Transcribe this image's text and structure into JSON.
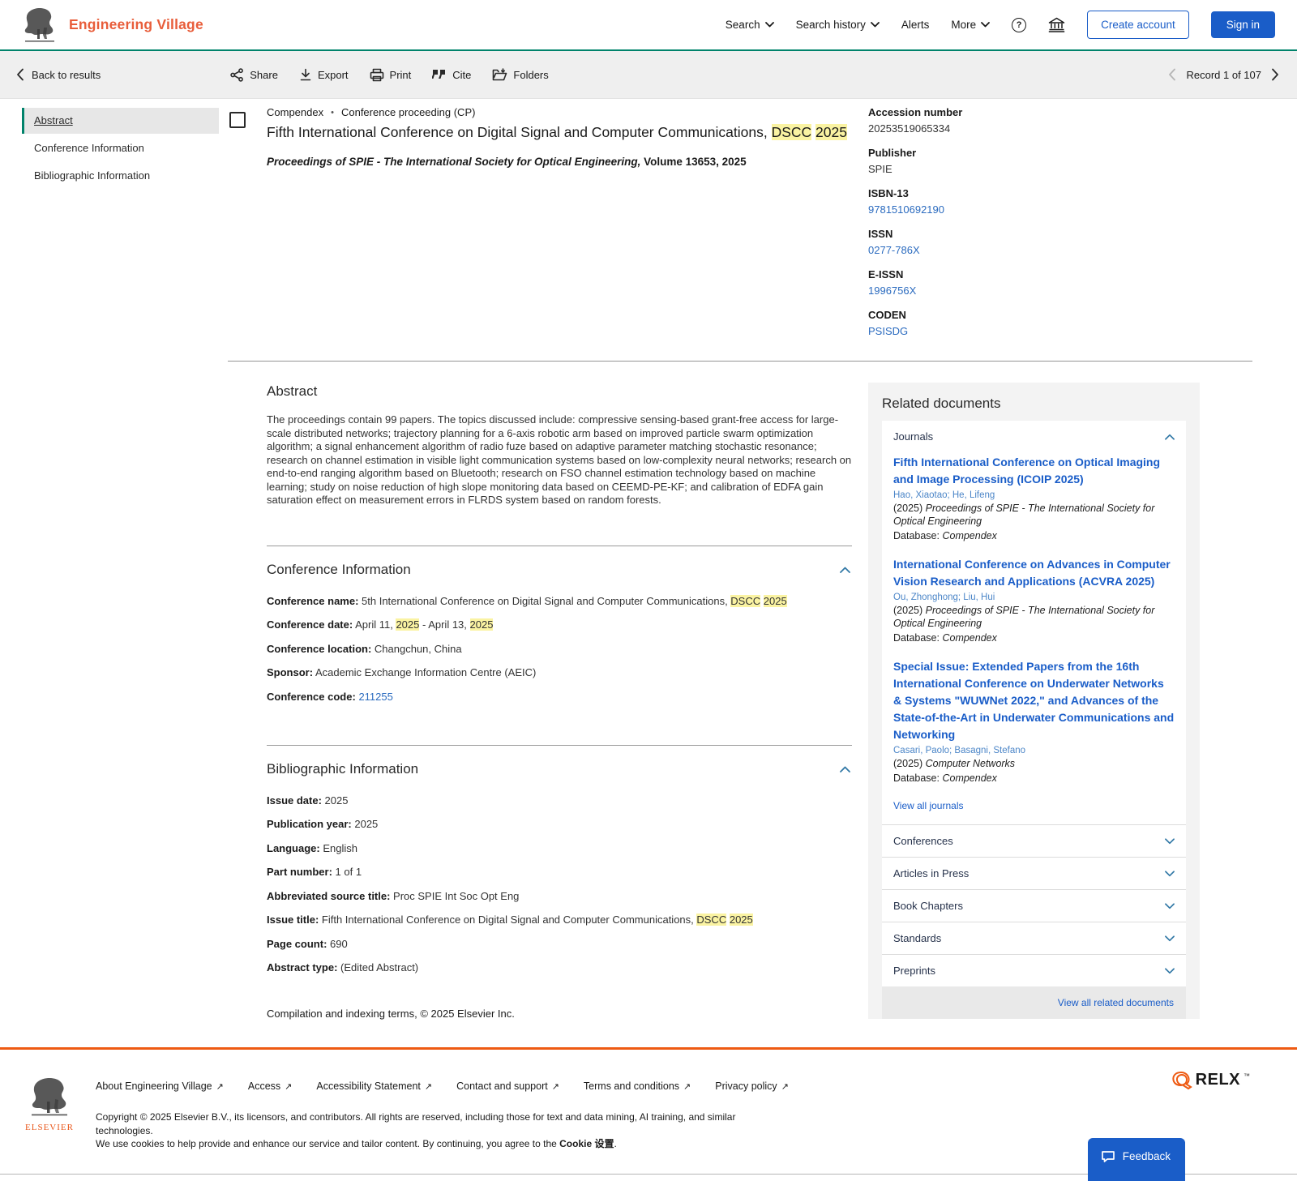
{
  "colors": {
    "brand_orange": "#e85d3a",
    "footer_orange": "#ee5a12",
    "teal": "#00836b",
    "primary_blue": "#1a5dc8",
    "link_blue": "#2b6bbf",
    "highlight": "#faf3a2"
  },
  "header": {
    "brand": "Engineering Village",
    "nav": [
      {
        "label": "Search"
      },
      {
        "label": "Search history"
      },
      {
        "label": "Alerts"
      },
      {
        "label": "More"
      }
    ],
    "create_account": "Create account",
    "sign_in": "Sign in"
  },
  "toolbar": {
    "back": "Back to results",
    "tools": [
      "Share",
      "Export",
      "Print",
      "Cite",
      "Folders"
    ],
    "record_nav": "Record 1 of 107"
  },
  "sidenav": {
    "items": [
      "Abstract",
      "Conference Information",
      "Bibliographic Information"
    ]
  },
  "record": {
    "database": "Compendex",
    "separator": "•",
    "doc_type": "Conference proceeding (CP)",
    "title_parts": [
      {
        "t": "Fifth International Conference on Digital Signal and Computer Communications, "
      },
      {
        "t": "DSCC",
        "m": true
      },
      {
        "t": " "
      },
      {
        "t": "2025",
        "m": true
      }
    ],
    "source_parts": [
      {
        "t": "Proceedings of SPIE - The International Society for Optical Engineering,",
        "b": true,
        "i": true
      },
      {
        "t": " Volume 13653, 2025",
        "b": true
      }
    ]
  },
  "metadata": {
    "groups": [
      {
        "label": "Accession number",
        "value": "20253519065334",
        "link": false
      },
      {
        "label": "Publisher",
        "value": "SPIE",
        "link": false
      },
      {
        "label": "ISBN-13",
        "value": "9781510692190",
        "link": true
      },
      {
        "label": "ISSN",
        "value": "0277-786X",
        "link": true
      },
      {
        "label": "E-ISSN",
        "value": "1996756X",
        "link": true
      },
      {
        "label": "CODEN",
        "value": "PSISDG",
        "link": true
      }
    ]
  },
  "abstract": {
    "heading": "Abstract",
    "text": "The proceedings contain 99 papers. The topics discussed include: compressive sensing-based grant-free access for large-scale distributed networks; trajectory planning for a 6-axis robotic arm based on improved particle swarm optimization algorithm; a signal enhancement algorithm of radio fuze based on adaptive parameter matching stochastic resonance; research on channel estimation in visible light communication systems based on low-complexity neural networks; research on end-to-end ranging algorithm based on Bluetooth; research on FSO channel estimation technology based on machine learning; study on noise reduction of high slope monitoring data based on CEEMD-PE-KF; and calibration of EDFA gain saturation effect on measurement errors in FLRDS system based on random forests."
  },
  "conference": {
    "heading": "Conference Information",
    "rows": [
      {
        "label": "Conference name:",
        "parts": [
          {
            "t": " 5th International Conference on Digital Signal and Computer Communications, "
          },
          {
            "t": "DSCC",
            "m": true
          },
          {
            "t": " "
          },
          {
            "t": "2025",
            "m": true
          }
        ]
      },
      {
        "label": "Conference date:",
        "parts": [
          {
            "t": " April 11, "
          },
          {
            "t": "2025",
            "m": true
          },
          {
            "t": " - April 13, "
          },
          {
            "t": "2025",
            "m": true
          }
        ]
      },
      {
        "label": "Conference location:",
        "parts": [
          {
            "t": " Changchun, China"
          }
        ]
      },
      {
        "label": "Sponsor:",
        "parts": [
          {
            "t": " Academic Exchange Information Centre (AEIC)"
          }
        ]
      },
      {
        "label": "Conference code:",
        "parts": [
          {
            "t": " "
          },
          {
            "t": "211255",
            "link": true
          }
        ]
      }
    ]
  },
  "biblio": {
    "heading": "Bibliographic Information",
    "rows": [
      {
        "label": "Issue date:",
        "parts": [
          {
            "t": " 2025"
          }
        ]
      },
      {
        "label": "Publication year:",
        "parts": [
          {
            "t": " 2025"
          }
        ]
      },
      {
        "label": "Language:",
        "parts": [
          {
            "t": " English"
          }
        ]
      },
      {
        "label": "Part number:",
        "parts": [
          {
            "t": " 1 of 1"
          }
        ]
      },
      {
        "label": "Abbreviated source title:",
        "parts": [
          {
            "t": " Proc SPIE Int Soc Opt Eng"
          }
        ]
      },
      {
        "label": "Issue title:",
        "parts": [
          {
            "t": " Fifth International Conference on Digital Signal and Computer Communications, "
          },
          {
            "t": "DSCC",
            "m": true
          },
          {
            "t": " "
          },
          {
            "t": "2025",
            "m": true
          }
        ]
      },
      {
        "label": "Page count:",
        "parts": [
          {
            "t": " 690"
          }
        ]
      },
      {
        "label": "Abstract type:",
        "parts": [
          {
            "t": " (Edited Abstract)"
          }
        ]
      }
    ]
  },
  "compilation": "Compilation and indexing terms, © 2025 Elsevier Inc.",
  "related": {
    "heading": "Related documents",
    "journals_label": "Journals",
    "journals": [
      {
        "title": "Fifth International Conference on Optical Imaging and Image Processing (ICOIP 2025)",
        "authors": "Hao, Xiaotao; He, Lifeng",
        "meta_parts": [
          {
            "t": "(2025) "
          },
          {
            "t": "Proceedings of SPIE - The International Society for Optical Engineering",
            "i": true
          }
        ],
        "db_parts": [
          {
            "t": "Database: "
          },
          {
            "t": "Compendex",
            "i": true
          }
        ]
      },
      {
        "title": "International Conference on Advances in Computer Vision Research and Applications (ACVRA 2025)",
        "authors": "Ou, Zhonghong;  Liu, Hui",
        "meta_parts": [
          {
            "t": "(2025) "
          },
          {
            "t": "Proceedings of SPIE - The International Society for Optical Engineering",
            "i": true
          }
        ],
        "db_parts": [
          {
            "t": "Database: "
          },
          {
            "t": "Compendex",
            "i": true
          }
        ]
      },
      {
        "title": "Special Issue: Extended Papers from the 16th International Conference on Underwater Networks & Systems \"WUWNet 2022,\" and Advances of the State-of-the-Art in Underwater Communications and Networking",
        "authors": "Casari, Paolo; Basagni, Stefano",
        "meta_parts": [
          {
            "t": "(2025) "
          },
          {
            "t": "Computer Networks",
            "i": true
          }
        ],
        "db_parts": [
          {
            "t": "Database: "
          },
          {
            "t": "Compendex",
            "i": true
          }
        ]
      }
    ],
    "view_all_journals": "View all journals",
    "accordions": [
      "Conferences",
      "Articles in Press",
      "Book Chapters",
      "Standards",
      "Preprints"
    ],
    "view_all": "View all related documents"
  },
  "footer": {
    "elsevier_word": "ELSEVIER",
    "links": [
      "About Engineering Village",
      "Access",
      "Accessibility Statement",
      "Contact and support",
      "Terms and conditions",
      "Privacy policy"
    ],
    "copyright": "Copyright © 2025 Elsevier B.V., its licensors, and contributors. All rights are reserved, including those for text and data mining, AI training, and similar technologies.",
    "cookie_parts": [
      {
        "t": "We use cookies to help provide and enhance our service and tailor content. By continuing, you agree to the "
      },
      {
        "t": "Cookie 设置",
        "b": true
      },
      {
        "t": "."
      }
    ],
    "relx_word": "RELX",
    "relx_tm": "™",
    "feedback": "Feedback"
  }
}
